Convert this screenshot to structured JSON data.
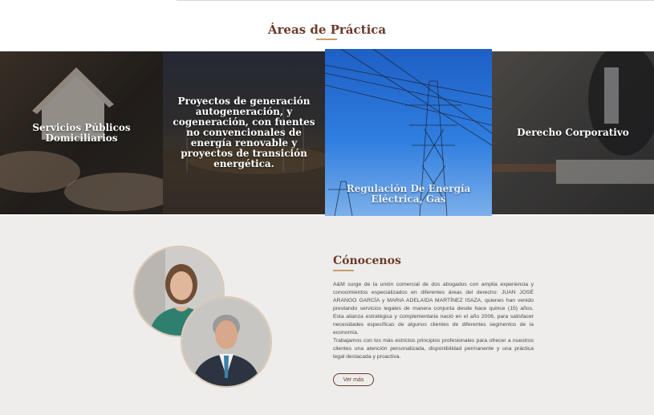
{
  "practice": {
    "title": "Áreas de Práctica",
    "cards": [
      {
        "label": "Servicios Públicos Domiciliarios"
      },
      {
        "label": "Proyectos de generación autogeneración, y cogeneración, con fuentes no convencionales de energía renovable y proyectos de transición energética."
      },
      {
        "label": "Regulación De Energía Eléctrica, Gas"
      },
      {
        "label": "Derecho Corporativo"
      }
    ]
  },
  "about": {
    "title": "Cónocenos",
    "paragraph_1": "A&M surge de la unión comercial de dos abogados con amplia experiencia y conocimientos especializados en diferentes áreas del derecho: JUAN JOSÉ ARANGO GARCÍA y MARIA ADELAIDA MARTÍNEZ ISAZA, quienes han venido prestando servicios legales de manera conjunta desde hace quince (15) años.  Esta alianza estratégica y complementaria nació en el año 2006, para satisfacer necesidades específicas de algunos clientes de diferentes segmentos de la economía.",
    "paragraph_2": "Trabajamos con los más estrictos principios profesionales para ofrecer a nuestros clientes una atención personalizada, disponibilidad permanente y una práctica legal destacada y proactiva.",
    "more_label": "Ver más"
  },
  "colors": {
    "brand_brown": "#6b3a2a",
    "accent_gold": "#c99b6a",
    "section_bg": "#eeedeb"
  }
}
